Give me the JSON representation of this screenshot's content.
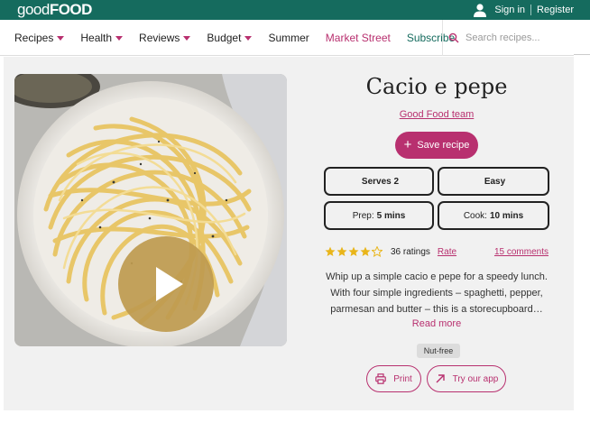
{
  "brand": {
    "logo_part1": "good",
    "logo_part2": "FOOD"
  },
  "account": {
    "sign_in": "Sign in",
    "register": "Register"
  },
  "nav": {
    "items": [
      {
        "label": "Recipes",
        "has_dropdown": true
      },
      {
        "label": "Health",
        "has_dropdown": true
      },
      {
        "label": "Reviews",
        "has_dropdown": true
      },
      {
        "label": "Budget",
        "has_dropdown": true
      },
      {
        "label": "Summer",
        "has_dropdown": false
      },
      {
        "label": "Market Street",
        "has_dropdown": false
      },
      {
        "label": "Subscribe",
        "has_dropdown": false
      }
    ],
    "search_placeholder": "Search recipes..."
  },
  "recipe": {
    "title": "Cacio e pepe",
    "author": "Good Food team",
    "save_label": "Save recipe",
    "serves": "Serves 2",
    "difficulty": "Easy",
    "prep_label": "Prep:",
    "prep_value": "5 mins",
    "cook_label": "Cook:",
    "cook_value": "10 mins",
    "rating_stars": 4,
    "ratings_text": "36 ratings",
    "rate_label": "Rate",
    "comments_label": "15 comments",
    "description": "Whip up a simple cacio e pepe for a speedy lunch. With four simple ingredients – spaghetti, pepper, parmesan and butter – this is a storecupboard…",
    "read_more": "Read more",
    "tag": "Nut-free",
    "print_label": "Print",
    "app_label": "Try our app"
  },
  "colors": {
    "brand_green": "#156b5e",
    "accent_pink": "#b8306f",
    "star_gold": "#e9b51a"
  }
}
